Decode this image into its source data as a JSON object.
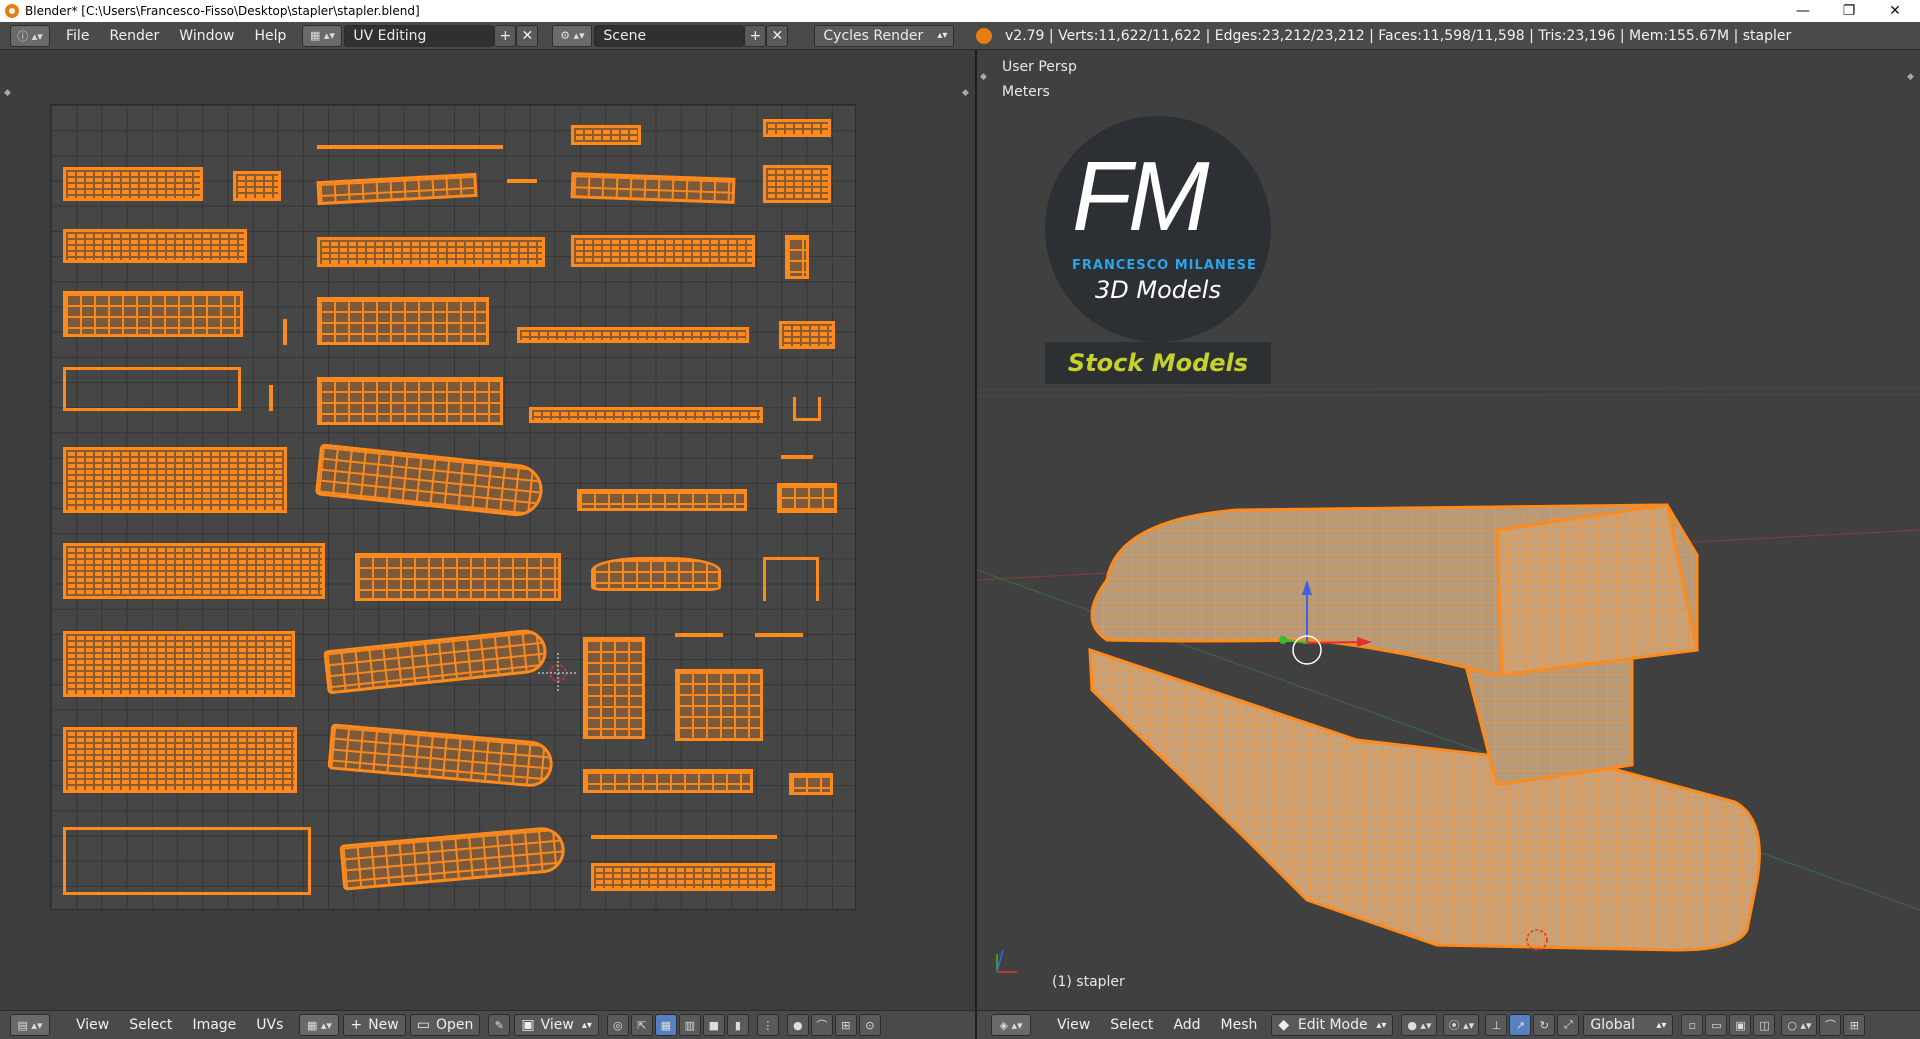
{
  "titlebar": {
    "title": "Blender* [C:\\Users\\Francesco-Fisso\\Desktop\\stapler\\stapler.blend]",
    "minimize": "—",
    "restore": "❐",
    "close": "✕"
  },
  "topbar": {
    "menus": [
      "File",
      "Render",
      "Window",
      "Help"
    ],
    "layout": "UV Editing",
    "scene": "Scene",
    "engine": "Cycles Render",
    "stats": "v2.79 | Verts:11,622/11,622 | Edges:23,212/23,212 | Faces:11,598/11,598 | Tris:23,196 | Mem:155.67M | stapler"
  },
  "viewport": {
    "view_name": "User Persp",
    "units": "Meters",
    "object_info": "(1) stapler",
    "logo": {
      "initials": "FM",
      "name": "FRANCESCO MILANESE",
      "tagline": "3D Models",
      "banner": "Stock Models"
    }
  },
  "uv_editor_bar": {
    "items": [
      "View",
      "Select",
      "Image",
      "UVs"
    ],
    "new_label": "New",
    "open_label": "Open",
    "view_label": "View"
  },
  "view3d_bar": {
    "items": [
      "View",
      "Select",
      "Add",
      "Mesh"
    ],
    "mode": "Edit Mode",
    "orientation": "Global"
  },
  "colors": {
    "accent": "#ff8a1c",
    "selection": "#5680c2",
    "banner_text": "#c8d12a",
    "logo_blue": "#2ba6e8"
  }
}
